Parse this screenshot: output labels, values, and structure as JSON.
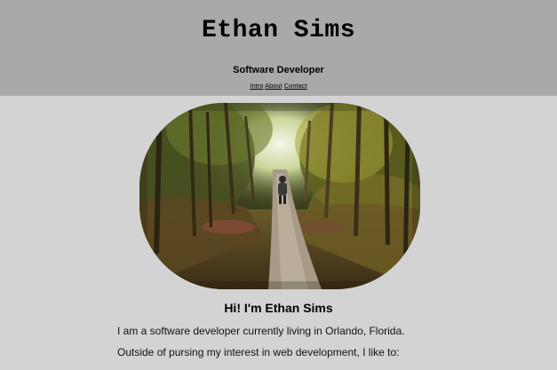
{
  "header": {
    "name": "Ethan Sims",
    "subtitle": "Software Developer",
    "nav": [
      {
        "label": "Intro"
      },
      {
        "label": "About"
      },
      {
        "label": "Contact"
      }
    ]
  },
  "hero": {
    "image_subject": "forest-trail-hiker-photo"
  },
  "intro": {
    "heading": "Hi! I'm Ethan Sims",
    "paragraphs": [
      "I am a software developer currently living in Orlando, Florida.",
      "Outside of pursing my interest in web development, I like to:"
    ]
  },
  "colors": {
    "header_bg": "#a9a9a9",
    "page_bg": "#d3d3d3"
  }
}
